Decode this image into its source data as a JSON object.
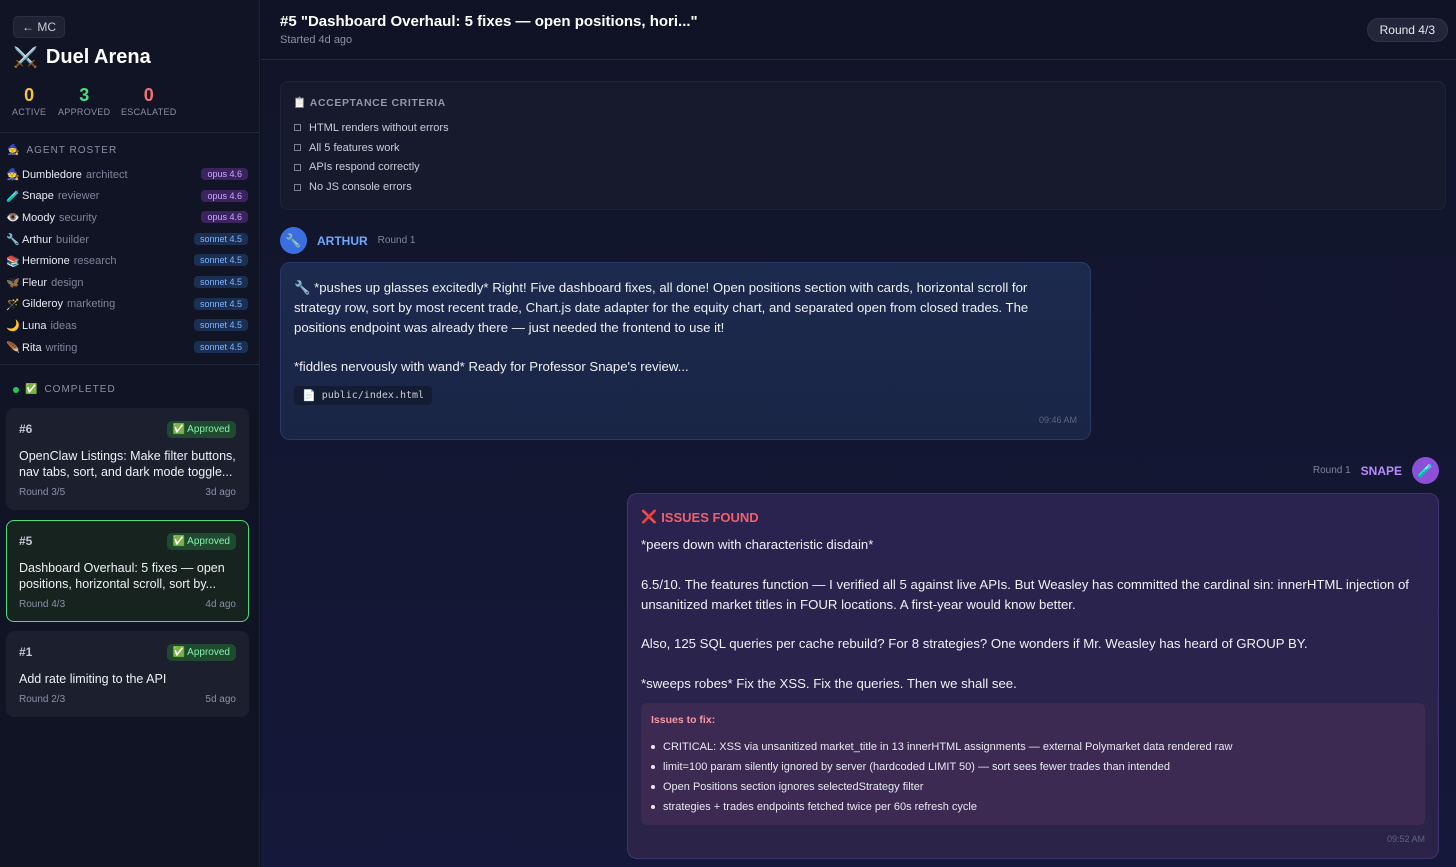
{
  "sidebar": {
    "back_label": "← MC",
    "title_icon": "⚔️",
    "title": "Duel Arena",
    "stats": [
      {
        "value": "0",
        "label": "ACTIVE",
        "color": "#f5c542"
      },
      {
        "value": "3",
        "label": "APPROVED",
        "color": "#4ade80"
      },
      {
        "value": "0",
        "label": "ESCALATED",
        "color": "#f87171"
      }
    ],
    "roster_icon": "🧙",
    "roster_label": "AGENT ROSTER",
    "roster": [
      {
        "icon": "🧙",
        "name": "Dumbledore",
        "role": "architect",
        "model": "opus 4.6"
      },
      {
        "icon": "🧪",
        "name": "Snape",
        "role": "reviewer",
        "model": "opus 4.6"
      },
      {
        "icon": "👁️",
        "name": "Moody",
        "role": "security",
        "model": "opus 4.6"
      },
      {
        "icon": "🔧",
        "name": "Arthur",
        "role": "builder",
        "model": "sonnet 4.5"
      },
      {
        "icon": "📚",
        "name": "Hermione",
        "role": "research",
        "model": "sonnet 4.5"
      },
      {
        "icon": "🦋",
        "name": "Fleur",
        "role": "design",
        "model": "sonnet 4.5"
      },
      {
        "icon": "🪄",
        "name": "Gilderoy",
        "role": "marketing",
        "model": "sonnet 4.5"
      },
      {
        "icon": "🌙",
        "name": "Luna",
        "role": "ideas",
        "model": "sonnet 4.5"
      },
      {
        "icon": "🪶",
        "name": "Rita",
        "role": "writing",
        "model": "sonnet 4.5"
      }
    ],
    "completed_icon": "✅",
    "completed_label": "COMPLETED",
    "tasks": [
      {
        "num": "#6",
        "badge": "✅ Approved",
        "title": "OpenClaw Listings: Make filter buttons, nav tabs, sort, and dark mode toggle...",
        "round": "Round 3/5",
        "age": "3d ago"
      },
      {
        "num": "#5",
        "badge": "✅ Approved",
        "title": "Dashboard Overhaul: 5 fixes — open positions, horizontal scroll, sort by...",
        "round": "Round 4/3",
        "age": "4d ago"
      },
      {
        "num": "#1",
        "badge": "✅ Approved",
        "title": "Add rate limiting to the API",
        "round": "Round 2/3",
        "age": "5d ago"
      }
    ]
  },
  "header": {
    "title": "#5 \"Dashboard Overhaul: 5 fixes — open positions, hori...\"",
    "subtitle": "Started 4d ago",
    "round_pill": "Round 4/3"
  },
  "criteria": {
    "title": "📋 ACCEPTANCE CRITERIA",
    "items": [
      "HTML renders without errors",
      "All 5 features work",
      "APIs respond correctly",
      "No JS console errors"
    ]
  },
  "messages": {
    "arthur": {
      "avatar_icon": "🔧",
      "name": "ARTHUR",
      "round": "Round 1",
      "line1": "🔧 *pushes up glasses excitedly* Right! Five dashboard fixes, all done! Open positions section with cards, horizontal scroll for strategy row, sort by most recent trade, Chart.js date adapter for the equity chart, and separated open from closed trades. The positions endpoint was already there — just needed the frontend to use it!",
      "line2": "*fiddles nervously with wand* Ready for Professor Snape's review...",
      "file_icon": "📄",
      "file": "public/index.html",
      "time": "09:46 AM"
    },
    "snape": {
      "avatar_icon": "🧪",
      "name": "SNAPE",
      "round": "Round 1",
      "heading_icon": "❌",
      "heading": "ISSUES FOUND",
      "p1": "*peers down with characteristic disdain*",
      "p2": "6.5/10. The features function — I verified all 5 against live APIs. But Weasley has committed the cardinal sin: innerHTML injection of unsanitized market titles in FOUR locations. A first-year would know better.",
      "p3": "Also, 125 SQL queries per cache rebuild? For 8 strategies? One wonders if Mr. Weasley has heard of GROUP BY.",
      "p4": "*sweeps robes* Fix the XSS. Fix the queries. Then we shall see.",
      "issues_title": "Issues to fix:",
      "issues": [
        "CRITICAL: XSS via unsanitized market_title in 13 innerHTML assignments — external Polymarket data rendered raw",
        "limit=100 param silently ignored by server (hardcoded LIMIT 50) — sort sees fewer trades than intended",
        "Open Positions section ignores selectedStrategy filter",
        "strategies + trades endpoints fetched twice per 60s refresh cycle"
      ],
      "time": "09:52 AM"
    }
  }
}
